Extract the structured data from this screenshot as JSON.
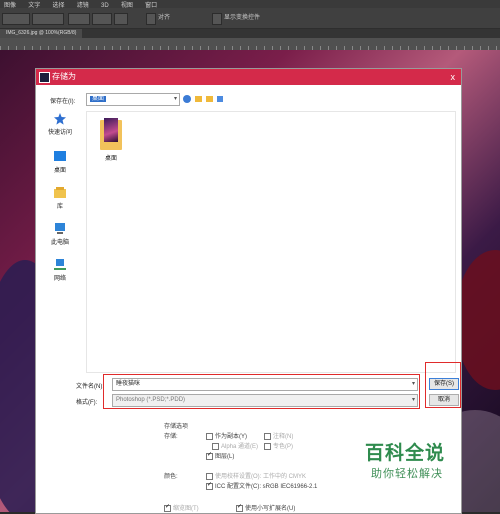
{
  "app": {
    "menu": [
      "图像",
      "文字",
      "选择",
      "滤镜",
      "3D",
      "视图",
      "窗口"
    ],
    "option_text_1": "对齐",
    "option_text_2": "显示变换控件",
    "doc_tab": "IMG_6326.jpg @ 100%(RGB/8)"
  },
  "dialog": {
    "title": "存储为",
    "close_glyph": "x",
    "save_in_label": "保存在(I):",
    "save_in_value": "桌面",
    "places": [
      {
        "label": "快速访问",
        "icon": "star-icon"
      },
      {
        "label": "桌面",
        "icon": "desktop-icon"
      },
      {
        "label": "库",
        "icon": "library-icon"
      },
      {
        "label": "此电脑",
        "icon": "computer-icon"
      },
      {
        "label": "网络",
        "icon": "network-icon"
      }
    ],
    "files": [
      {
        "name": "桌面"
      }
    ],
    "filename_label": "文件名(N):",
    "filename_value": "睡夜猫咪",
    "format_label": "格式(F):",
    "format_value": "Photoshop (*.PSD;*.PDD)",
    "save_button": "保存(S)",
    "cancel_button": "取消",
    "options": {
      "section_label": "存储选项",
      "store_label": "存储:",
      "as_copy": "作为副本(Y)",
      "notes": "注释(N)",
      "alpha": "Alpha 通道(E)",
      "spot": "专色(P)",
      "layers": "图层(L)",
      "color_label": "颜色:",
      "proof": "使用校样设置(O):",
      "proof_value": "工作中的 CMYK",
      "icc": "ICC 配置文件(C):",
      "icc_value": "sRGB IEC61966-2.1",
      "thumbnail": "缩览图(T)",
      "lowercase_ext": "使用小写扩展名(U)"
    }
  },
  "watermark": {
    "title": "百科全说",
    "subtitle": "助你轻松解决"
  },
  "colors": {
    "titlebar": "#d42a4a",
    "highlight_red": "#e02b2b",
    "selection_blue": "#2f6fc9",
    "watermark_green": "#2f8b4e"
  }
}
